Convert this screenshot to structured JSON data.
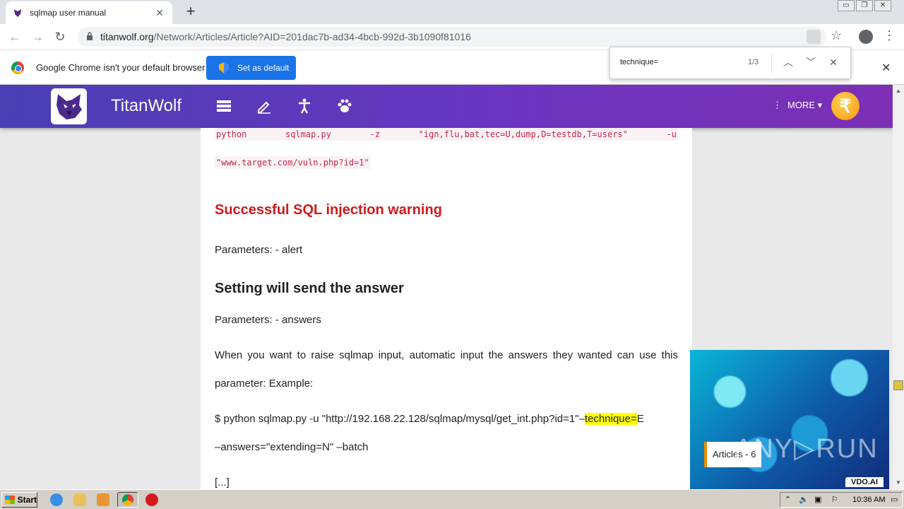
{
  "browser": {
    "tab_title": "sqlmap user manual",
    "tab_close": "✕",
    "new_tab": "+",
    "url_host": "titanwolf.org",
    "url_path": "/Network/Articles/Article?AID=201dac7b-ad34-4bcb-992d-3b1090f81016"
  },
  "infobar": {
    "message": "Google Chrome isn't your default browser",
    "button": "Set as default",
    "close": "✕"
  },
  "findbar": {
    "query": "technique=",
    "count": "1/3",
    "up": "⌃",
    "down": "⌄",
    "close": "✕"
  },
  "site": {
    "brand": "TitanWolf",
    "more": "MORE ▾",
    "coin": "₹"
  },
  "article": {
    "code_tokens": [
      "python",
      "sqlmap.py",
      "-z",
      "\"ign,flu,bat,tec=U,dump,D=testdb,T=users\"",
      "-u"
    ],
    "code_line2": "\"www.target.com/vuln.php?id=1\"",
    "heading_warning": "Successful SQL injection warning",
    "param_alert": "Parameters: - alert",
    "heading_answer": "Setting will send the answer",
    "param_answers": "Parameters: - answers",
    "desc_line1": "When you want to raise sqlmap input, automatic input the answers they wanted can use this",
    "desc_line2": "parameter: Example:",
    "example_prefix": "$ python sqlmap.py -u \"http://192.168.22.128/sqlmap/mysql/get_int.php?id=1\"–",
    "example_highlight": "technique=",
    "example_suffix": "E",
    "example_line2": "–answers=\"extending=N\" –batch",
    "ellipsis": "[...]"
  },
  "ad": {
    "label": "Articles - 6",
    "brand": "VDO.AI",
    "watermark": "ANY▷RUN"
  },
  "taskbar": {
    "start": "Start",
    "clock": "10:36 AM"
  },
  "colors": {
    "header_start": "#4a3fb5",
    "header_end": "#7c2fb5",
    "warning_red": "#d11a1a",
    "code_red": "#c7254e",
    "highlight": "#ffff00",
    "chrome_blue": "#1a73e8"
  }
}
